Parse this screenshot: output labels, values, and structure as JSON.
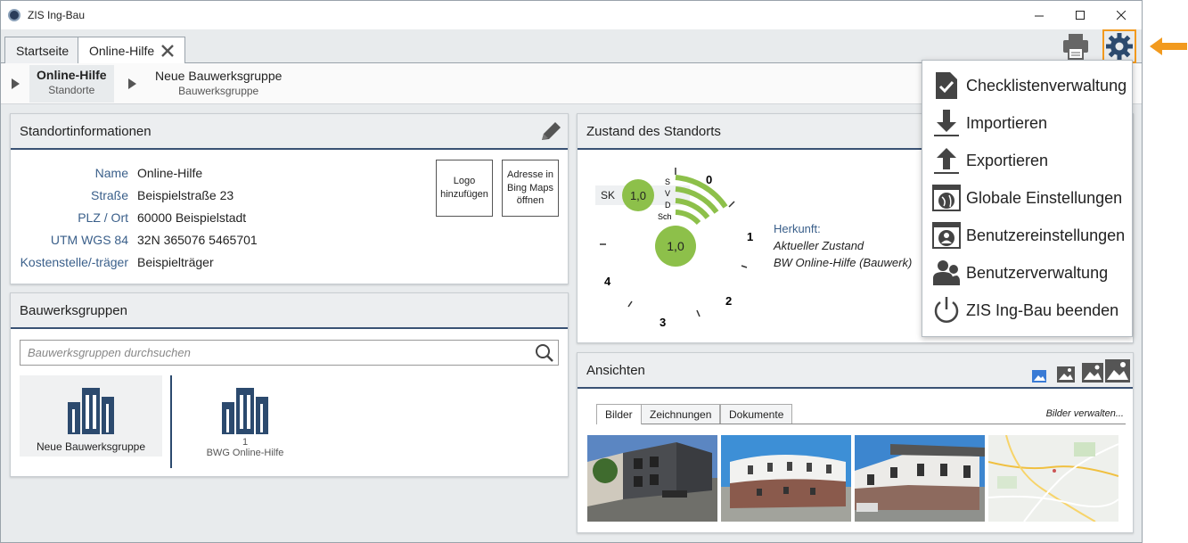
{
  "window": {
    "title": "ZIS Ing-Bau"
  },
  "tabs": [
    {
      "label": "Startseite"
    },
    {
      "label": "Online-Hilfe"
    }
  ],
  "breadcrumb": [
    {
      "title": "Online-Hilfe",
      "subtitle": "Standorte"
    },
    {
      "title": "Neue Bauwerksgruppe",
      "subtitle": "Bauwerksgruppe"
    }
  ],
  "standort": {
    "title": "Standortinformationen",
    "fields": [
      {
        "label": "Name",
        "value": "Online-Hilfe"
      },
      {
        "label": "Straße",
        "value": "Beispielstraße 23"
      },
      {
        "label": "PLZ / Ort",
        "value": "60000 Beispielstadt"
      },
      {
        "label": "UTM WGS 84",
        "value": "32N 365076 5465701"
      },
      {
        "label": "Kostenstelle/-träger",
        "value": "Beispielträger"
      }
    ],
    "logo_button": "Logo hinzufügen",
    "bing_button": "Adresse in Bing Maps öffnen"
  },
  "bauwerksgruppen": {
    "title": "Bauwerksgruppen",
    "search_placeholder": "Bauwerksgruppen durchsuchen",
    "items": [
      {
        "count": "",
        "label": "Neue Bauwerksgruppe"
      },
      {
        "count": "1",
        "label": "BWG Online-Hilfe"
      }
    ]
  },
  "zustand": {
    "title": "Zustand des Standorts",
    "sk_label": "SK",
    "sk_value": "1,0",
    "main_value": "1,0",
    "factors": [
      "S",
      "V",
      "D",
      "Sch"
    ],
    "scale": [
      "0",
      "1",
      "2",
      "3",
      "4"
    ],
    "herkunft_label": "Herkunft:",
    "herkunft_lines": [
      "Aktueller Zustand",
      "BW Online-Hilfe (Bauwerk)"
    ]
  },
  "ansichten": {
    "title": "Ansichten",
    "tabs": [
      "Bilder",
      "Zeichnungen",
      "Dokumente"
    ],
    "manage_link": "Bilder verwalten..."
  },
  "settings_menu": {
    "items": [
      {
        "label": "Checklistenverwaltung",
        "icon": "checklist-icon"
      },
      {
        "label": "Importieren",
        "icon": "import-icon"
      },
      {
        "label": "Exportieren",
        "icon": "export-icon"
      },
      {
        "label": "Globale Einstellungen",
        "icon": "globe-settings-icon"
      },
      {
        "label": "Benutzereinstellungen",
        "icon": "user-settings-icon"
      },
      {
        "label": "Benutzerverwaltung",
        "icon": "user-management-icon"
      },
      {
        "label": "ZIS Ing-Bau beenden",
        "icon": "power-icon"
      }
    ]
  },
  "colors": {
    "accent": "#f29a1e",
    "navy": "#3a5274",
    "green": "#8dc04a",
    "label_blue": "#3a5f8a"
  }
}
